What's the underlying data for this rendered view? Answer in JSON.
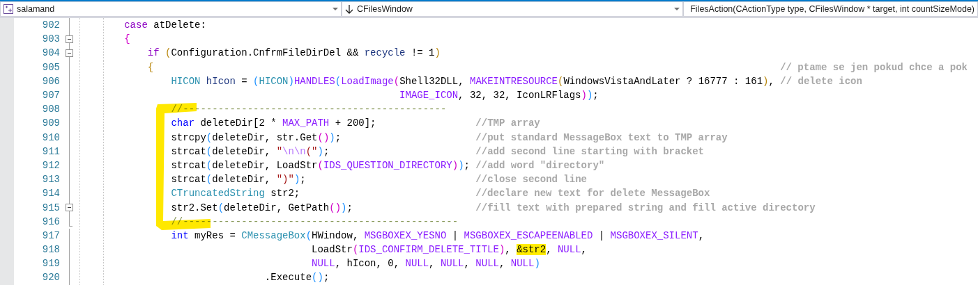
{
  "navigation_bar": [
    {
      "kind": "project",
      "text": "salamand"
    },
    {
      "kind": "class",
      "text": "CFilesWindow"
    },
    {
      "kind": "member",
      "text": "FilesAction(CActionType type, CFilesWindow * target, int countSizeMode)"
    }
  ],
  "editor": {
    "lines": [
      {
        "number": "902",
        "fold_marker": {
          "kind": "line"
        },
        "tokens": [
          {
            "kind": "control",
            "text": "        case"
          },
          {
            "kind": "plain",
            "text": " atDelete:"
          }
        ]
      },
      {
        "number": "903",
        "fold_marker": {
          "kind": "toggle",
          "expanded": true
        },
        "tokens": [
          {
            "kind": "brace_magenta",
            "text": "        {"
          }
        ]
      },
      {
        "number": "904",
        "fold_marker": {
          "kind": "toggle",
          "expanded": true
        },
        "tokens": [
          {
            "kind": "control",
            "text": "            if"
          },
          {
            "kind": "brace_gold",
            "text": " ("
          },
          {
            "kind": "plain",
            "text": "Configuration.CnfrmFileDirDel &&"
          },
          {
            "kind": "variable",
            "text": " recycle"
          },
          {
            "kind": "plain",
            "text": " != 1"
          },
          {
            "kind": "brace_gold",
            "text": ")"
          }
        ]
      },
      {
        "number": "905",
        "fold_marker": {
          "kind": "line"
        },
        "tokens": [
          {
            "kind": "brace_gold",
            "text": "            {"
          },
          {
            "kind": "comment",
            "text": "                                                                                                           // ptame se jen pokud chce a pok"
          }
        ]
      },
      {
        "number": "906",
        "fold_marker": {
          "kind": "line"
        },
        "tokens": [
          {
            "kind": "type",
            "text": "                HICON"
          },
          {
            "kind": "variable",
            "text": " hIcon"
          },
          {
            "kind": "plain",
            "text": " ="
          },
          {
            "kind": "brace_blue",
            "text": " ("
          },
          {
            "kind": "type",
            "text": "HICON"
          },
          {
            "kind": "brace_blue",
            "text": ")"
          },
          {
            "kind": "macro",
            "text": "HANDLES"
          },
          {
            "kind": "brace_blue",
            "text": "("
          },
          {
            "kind": "macro",
            "text": "LoadImage"
          },
          {
            "kind": "brace_magenta",
            "text": "("
          },
          {
            "kind": "plain",
            "text": "Shell32DLL,"
          },
          {
            "kind": "macro",
            "text": " MAKEINTRESOURCE"
          },
          {
            "kind": "brace_gold",
            "text": "("
          },
          {
            "kind": "plain",
            "text": "WindowsVistaAndLater ? 16777 : 161"
          },
          {
            "kind": "brace_gold",
            "text": ")"
          },
          {
            "kind": "plain",
            "text": ","
          },
          {
            "kind": "comment",
            "text": " // delete icon"
          }
        ]
      },
      {
        "number": "907",
        "fold_marker": {
          "kind": "line"
        },
        "tokens": [
          {
            "kind": "macro",
            "text": "                                                       IMAGE_ICON"
          },
          {
            "kind": "plain",
            "text": ", 32, 32, IconLRFlags"
          },
          {
            "kind": "brace_magenta",
            "text": ")"
          },
          {
            "kind": "brace_blue",
            "text": ")"
          },
          {
            "kind": "plain",
            "text": ";"
          }
        ]
      },
      {
        "number": "908",
        "fold_marker": {
          "kind": "line"
        },
        "tokens": [
          {
            "kind": "divider",
            "text": "                //---------------------------------------------"
          }
        ]
      },
      {
        "number": "909",
        "fold_marker": {
          "kind": "line"
        },
        "tokens": [
          {
            "kind": "keyword",
            "text": "                char"
          },
          {
            "kind": "plain",
            "text": " deleteDir[2 *"
          },
          {
            "kind": "macro",
            "text": " MAX_PATH"
          },
          {
            "kind": "plain",
            "text": " + 200];"
          },
          {
            "kind": "comment",
            "text": "                 //TMP array"
          }
        ]
      },
      {
        "number": "910",
        "fold_marker": {
          "kind": "line"
        },
        "tokens": [
          {
            "kind": "plain",
            "text": "                strcpy"
          },
          {
            "kind": "brace_blue",
            "text": "("
          },
          {
            "kind": "plain",
            "text": "deleteDir, str.Get"
          },
          {
            "kind": "brace_magenta",
            "text": "()"
          },
          {
            "kind": "brace_blue",
            "text": ")"
          },
          {
            "kind": "plain",
            "text": ";"
          },
          {
            "kind": "comment",
            "text": "                       //put standard MessageBox text to TMP array"
          }
        ]
      },
      {
        "number": "911",
        "fold_marker": {
          "kind": "line"
        },
        "tokens": [
          {
            "kind": "plain",
            "text": "                strcat"
          },
          {
            "kind": "brace_blue",
            "text": "("
          },
          {
            "kind": "plain",
            "text": "deleteDir,"
          },
          {
            "kind": "string",
            "text": " \""
          },
          {
            "kind": "escape",
            "text": "\\n\\n"
          },
          {
            "kind": "string",
            "text": "(\""
          },
          {
            "kind": "brace_blue",
            "text": ")"
          },
          {
            "kind": "plain",
            "text": ";"
          },
          {
            "kind": "comment",
            "text": "                         //add second line starting with bracket"
          }
        ]
      },
      {
        "number": "912",
        "fold_marker": {
          "kind": "line"
        },
        "tokens": [
          {
            "kind": "plain",
            "text": "                strcat"
          },
          {
            "kind": "brace_blue",
            "text": "("
          },
          {
            "kind": "plain",
            "text": "deleteDir, LoadStr"
          },
          {
            "kind": "brace_magenta",
            "text": "("
          },
          {
            "kind": "macro",
            "text": "IDS_QUESTION_DIRECTORY"
          },
          {
            "kind": "brace_magenta",
            "text": ")"
          },
          {
            "kind": "brace_blue",
            "text": ")"
          },
          {
            "kind": "plain",
            "text": ";"
          },
          {
            "kind": "comment",
            "text": " //add word \"directory\""
          }
        ]
      },
      {
        "number": "913",
        "fold_marker": {
          "kind": "line"
        },
        "tokens": [
          {
            "kind": "plain",
            "text": "                strcat"
          },
          {
            "kind": "brace_blue",
            "text": "("
          },
          {
            "kind": "plain",
            "text": "deleteDir,"
          },
          {
            "kind": "string",
            "text": " \")\""
          },
          {
            "kind": "brace_blue",
            "text": ")"
          },
          {
            "kind": "plain",
            "text": ";"
          },
          {
            "kind": "comment",
            "text": "                             //close second line"
          }
        ]
      },
      {
        "number": "914",
        "fold_marker": {
          "kind": "line"
        },
        "tokens": [
          {
            "kind": "type",
            "text": "                CTruncatedString"
          },
          {
            "kind": "plain",
            "text": " str2;"
          },
          {
            "kind": "comment",
            "text": "                              //declare new text for delete MessageBox"
          }
        ]
      },
      {
        "number": "915",
        "fold_marker": {
          "kind": "toggle",
          "expanded": true
        },
        "tokens": [
          {
            "kind": "plain",
            "text": "                str2.Set"
          },
          {
            "kind": "brace_blue",
            "text": "("
          },
          {
            "kind": "plain",
            "text": "deleteDir, GetPath"
          },
          {
            "kind": "brace_magenta",
            "text": "()"
          },
          {
            "kind": "brace_blue",
            "text": ")"
          },
          {
            "kind": "plain",
            "text": ";"
          },
          {
            "kind": "comment",
            "text": "                     //fill text with prepared string and fill active directory"
          }
        ]
      },
      {
        "number": "916",
        "fold_marker": {
          "kind": "end"
        },
        "tokens": [
          {
            "kind": "divider",
            "text": "                //-----------------------------------------------"
          }
        ]
      },
      {
        "number": "917",
        "fold_marker": {
          "kind": "line"
        },
        "tokens": [
          {
            "kind": "keyword",
            "text": "                int"
          },
          {
            "kind": "plain",
            "text": " myRes ="
          },
          {
            "kind": "type",
            "text": " CMessageBox"
          },
          {
            "kind": "brace_blue",
            "text": "("
          },
          {
            "kind": "plain",
            "text": "HWindow,"
          },
          {
            "kind": "macro",
            "text": " MSGBOXEX_YESNO"
          },
          {
            "kind": "plain",
            "text": " |"
          },
          {
            "kind": "macro",
            "text": " MSGBOXEX_ESCAPEENABLED"
          },
          {
            "kind": "plain",
            "text": " |"
          },
          {
            "kind": "macro",
            "text": " MSGBOXEX_SILENT"
          },
          {
            "kind": "plain",
            "text": ","
          }
        ]
      },
      {
        "number": "918",
        "fold_marker": {
          "kind": "line"
        },
        "tokens": [
          {
            "kind": "plain",
            "text": "                                        LoadStr"
          },
          {
            "kind": "brace_magenta",
            "text": "("
          },
          {
            "kind": "macro",
            "text": "IDS_CONFIRM_DELETE_TITLE"
          },
          {
            "kind": "brace_magenta",
            "text": ")"
          },
          {
            "kind": "plain",
            "text": ","
          },
          {
            "kind": "marked",
            "text": " &str2"
          },
          {
            "kind": "plain",
            "text": ","
          },
          {
            "kind": "macro",
            "text": " NULL"
          },
          {
            "kind": "plain",
            "text": ","
          }
        ]
      },
      {
        "number": "919",
        "fold_marker": {
          "kind": "line"
        },
        "tokens": [
          {
            "kind": "macro",
            "text": "                                        NULL"
          },
          {
            "kind": "plain",
            "text": ", hIcon, 0,"
          },
          {
            "kind": "macro",
            "text": " NULL"
          },
          {
            "kind": "plain",
            "text": ","
          },
          {
            "kind": "macro",
            "text": " NULL"
          },
          {
            "kind": "plain",
            "text": ","
          },
          {
            "kind": "macro",
            "text": " NULL"
          },
          {
            "kind": "plain",
            "text": ","
          },
          {
            "kind": "macro",
            "text": " NULL"
          },
          {
            "kind": "brace_blue",
            "text": ")"
          }
        ]
      },
      {
        "number": "920",
        "fold_marker": {
          "kind": "line"
        },
        "tokens": [
          {
            "kind": "plain",
            "text": "                                .Execute"
          },
          {
            "kind": "brace_blue",
            "text": "()"
          },
          {
            "kind": "plain",
            "text": ";"
          }
        ]
      }
    ]
  }
}
